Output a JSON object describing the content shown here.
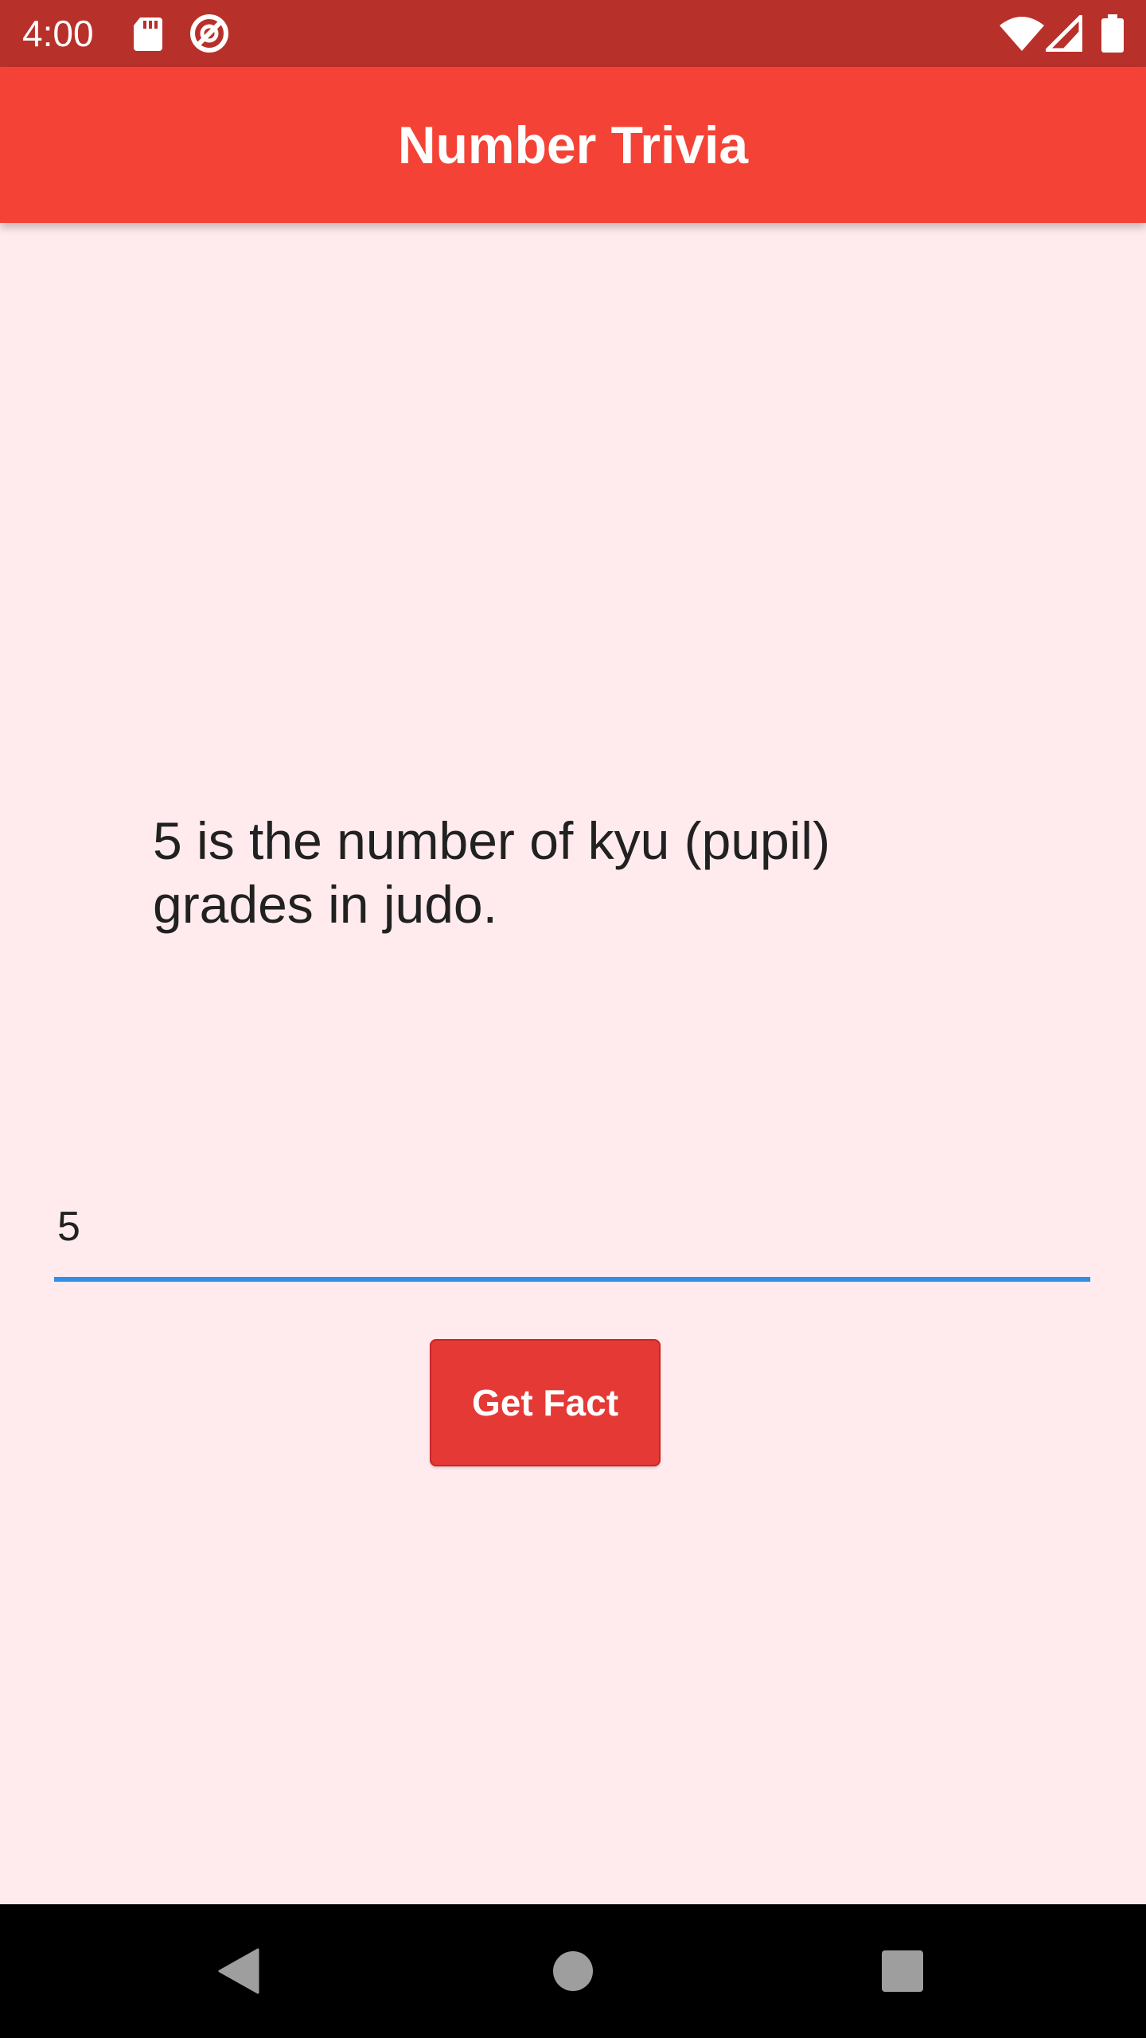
{
  "status_bar": {
    "time": "4:00",
    "icons": [
      "sd-card-icon",
      "sync-icon",
      "wifi-icon",
      "signal-icon",
      "battery-icon"
    ]
  },
  "app_bar": {
    "title": "Number Trivia"
  },
  "content": {
    "fact": "5 is the number of kyu (pupil) grades in judo.",
    "number_input_value": "5",
    "get_fact_label": "Get Fact"
  },
  "nav_bar": {
    "icons": [
      "back-icon",
      "home-icon",
      "recents-icon"
    ]
  },
  "colors": {
    "status_bar": "#b8302a",
    "app_bar": "#f44336",
    "background": "#ffebee",
    "button": "#e53935",
    "input_underline": "#2f8fe6"
  }
}
